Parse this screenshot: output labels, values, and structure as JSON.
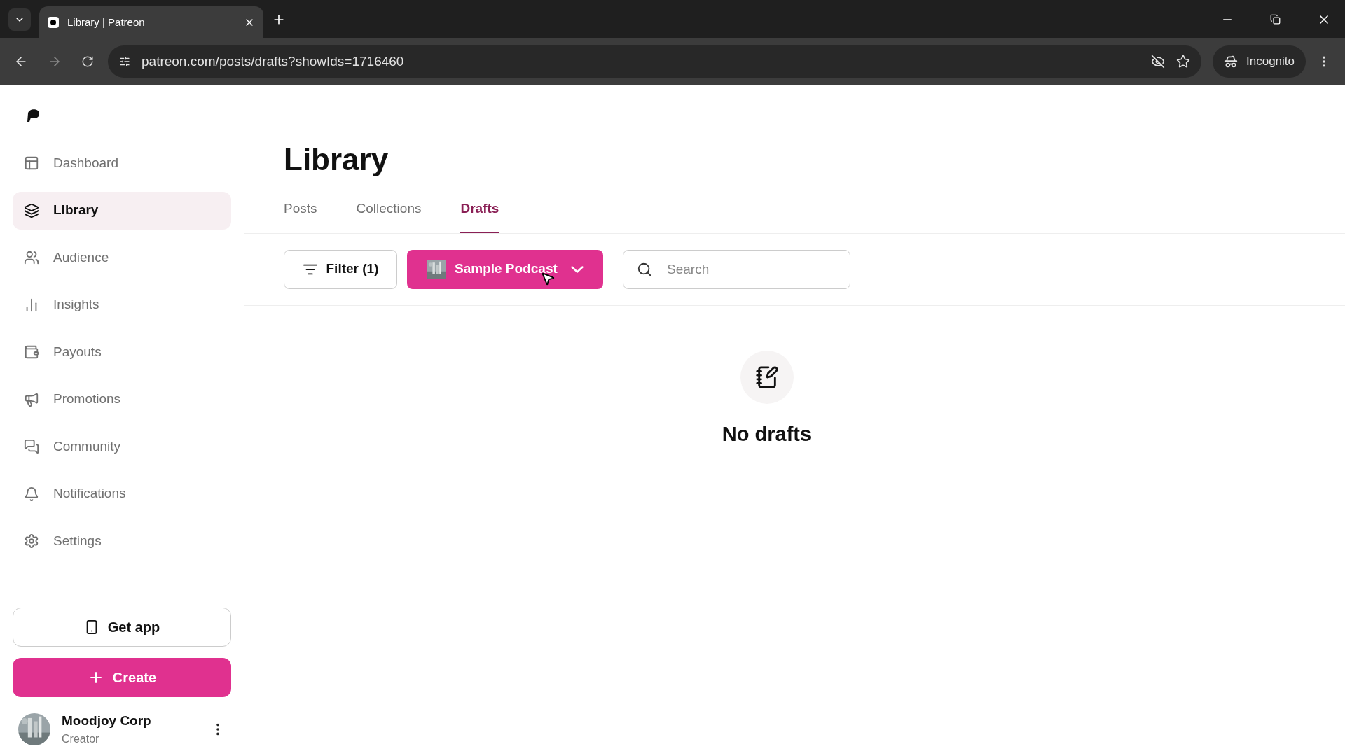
{
  "browser": {
    "tab_title": "Library | Patreon",
    "url": "patreon.com/posts/drafts?showIds=1716460",
    "profile": "Incognito"
  },
  "sidebar": {
    "items": [
      {
        "label": "Dashboard",
        "selected": false
      },
      {
        "label": "Library",
        "selected": true
      },
      {
        "label": "Audience",
        "selected": false
      },
      {
        "label": "Insights",
        "selected": false
      },
      {
        "label": "Payouts",
        "selected": false
      },
      {
        "label": "Promotions",
        "selected": false
      },
      {
        "label": "Community",
        "selected": false
      },
      {
        "label": "Notifications",
        "selected": false
      },
      {
        "label": "Settings",
        "selected": false
      }
    ],
    "get_app": "Get app",
    "create": "Create",
    "user": {
      "name": "Moodjoy Corp",
      "role": "Creator"
    }
  },
  "page": {
    "title": "Library",
    "tabs": [
      {
        "label": "Posts",
        "selected": false
      },
      {
        "label": "Collections",
        "selected": false
      },
      {
        "label": "Drafts",
        "selected": true
      }
    ],
    "filter": "Filter (1)",
    "campaign": "Sample Podcast",
    "search": {
      "placeholder": "Search"
    },
    "empty": {
      "title": "No drafts"
    }
  }
}
